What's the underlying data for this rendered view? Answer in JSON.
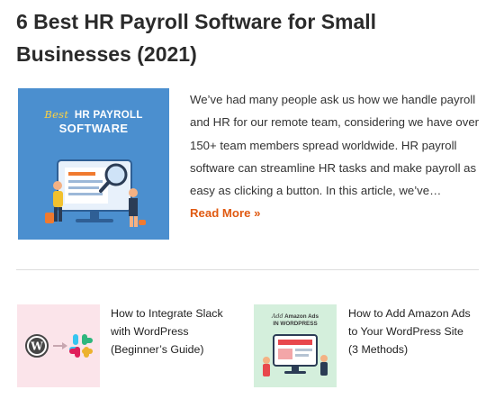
{
  "article": {
    "title": "6 Best HR Payroll Software for Small Businesses (2021)",
    "thumbnail": {
      "best_word": "Best",
      "line1": "HR PAYROLL",
      "line2": "SOFTWARE"
    },
    "excerpt": "We’ve had many people ask us how we handle payroll and HR for our remote team, considering we have over 150+ team members spread worldwide. HR payroll software can streamline HR tasks and make payroll as easy as clicking a button. In this article, we’ve…",
    "read_more": "Read More »"
  },
  "related": [
    {
      "title": "How to Integrate Slack with WordPress (Beginner’s Guide)",
      "thumb_icons": [
        "wordpress-logo",
        "slack-logo"
      ]
    },
    {
      "title": "How to Add Amazon Ads to Your WordPress Site (3 Methods)",
      "thumb_label_italic": "Add",
      "thumb_label_rest": "Amazon Ads",
      "thumb_label_line2": "IN WORDPRESS"
    }
  ],
  "colors": {
    "title": "#2b2b2b",
    "read_more": "#e05a12",
    "featured_bg": "#4b8fcf",
    "slack_thumb_bg": "#fbe4ea",
    "amazon_thumb_bg": "#d4efdc"
  }
}
